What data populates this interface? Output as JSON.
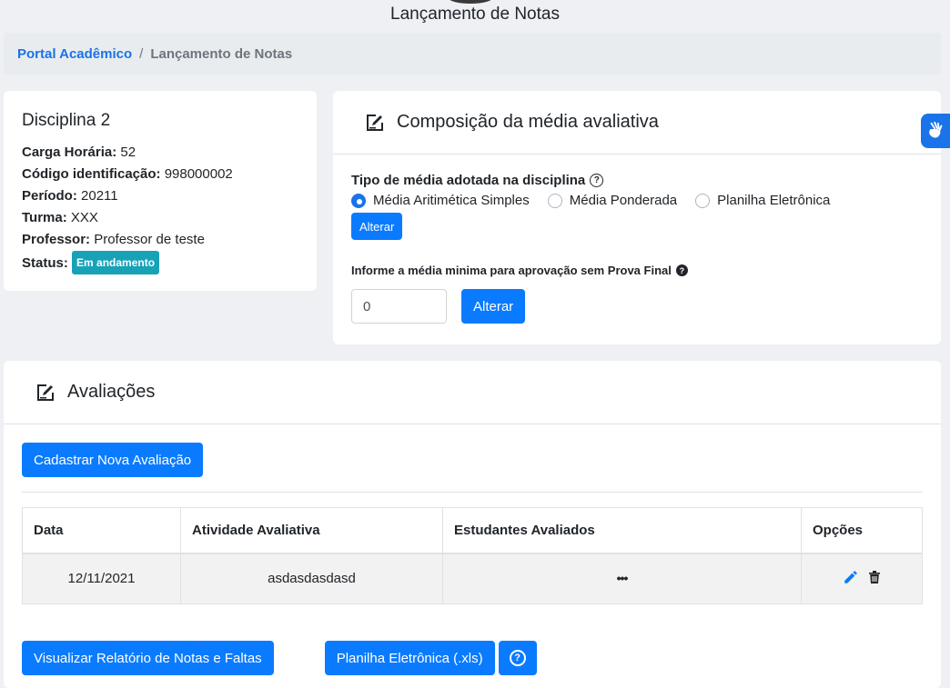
{
  "page": {
    "title": "Lançamento de Notas"
  },
  "breadcrumb": {
    "home": "Portal Acadêmico",
    "separator": "/",
    "current": "Lançamento de Notas"
  },
  "discipline": {
    "name": "Disciplina 2",
    "fields": [
      {
        "label": "Carga Horária:",
        "value": "52"
      },
      {
        "label": "Código identificação:",
        "value": "998000002"
      },
      {
        "label": "Período:",
        "value": "20211"
      },
      {
        "label": "Turma:",
        "value": "XXX"
      },
      {
        "label": "Professor:",
        "value": "Professor de teste"
      }
    ],
    "status_label": "Status:",
    "status_badge": "Em andamento"
  },
  "composition": {
    "title": "Composição da média avaliativa",
    "type_label": "Tipo de média adotada na disciplina",
    "options": [
      {
        "label": "Média Aritimética Simples",
        "selected": true
      },
      {
        "label": "Média Ponderada",
        "selected": false
      },
      {
        "label": "Planilha Eletrônica",
        "selected": false
      }
    ],
    "change_button": "Alterar",
    "min_label": "Informe a média minima para aprovação sem Prova Final",
    "min_value": "0",
    "min_button": "Alterar"
  },
  "evaluations": {
    "title": "Avaliações",
    "new_button": "Cadastrar Nova Avaliação",
    "columns": [
      "Data",
      "Atividade Avaliativa",
      "Estudantes Avaliados",
      "Opções"
    ],
    "rows": [
      {
        "date": "12/11/2021",
        "activity": "asdasdasdasd",
        "students": "•••"
      }
    ],
    "report_button": "Visualizar Relatório de Notas e Faltas",
    "spreadsheet_button": "Planilha Eletrônica (.xls)"
  },
  "icons": {
    "accent": "#0a7bff",
    "badge_color": "#17a2b8"
  }
}
